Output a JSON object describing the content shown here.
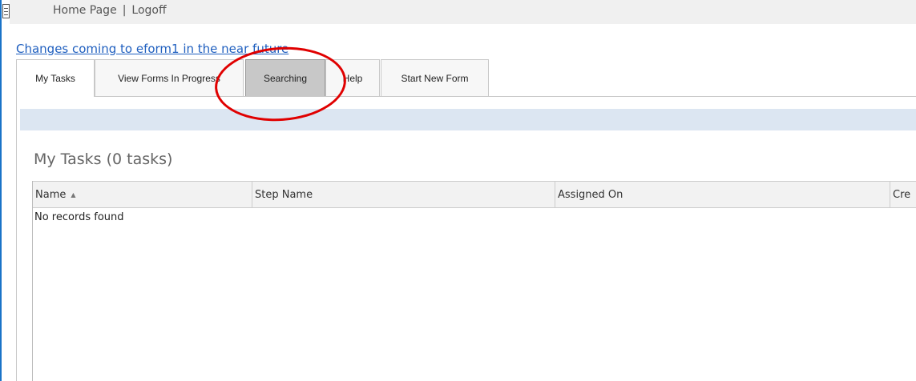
{
  "topnav": {
    "home": "Home Page",
    "separator": "|",
    "logoff": "Logoff"
  },
  "notice": {
    "text": "Changes coming to eform1 in the near future"
  },
  "tabs": [
    {
      "label": "My Tasks",
      "state": "active"
    },
    {
      "label": "View Forms In Progress",
      "state": "normal"
    },
    {
      "label": "Searching",
      "state": "highlighted"
    },
    {
      "label": "Help",
      "state": "normal"
    },
    {
      "label": "Start New Form",
      "state": "normal"
    }
  ],
  "section": {
    "title": "My Tasks (0 tasks)"
  },
  "grid": {
    "columns": [
      {
        "label": "Name",
        "sort": "ascending"
      },
      {
        "label": "Step Name"
      },
      {
        "label": "Assigned On"
      },
      {
        "label": "Cre"
      }
    ],
    "empty_message": "No records found",
    "rows": []
  },
  "icons": {
    "menu": "menu-icon",
    "sort": "sort-ascending-icon"
  },
  "colors": {
    "link": "#1f5fbf",
    "info_bar": "#dce6f2",
    "annotation": "#e00000",
    "highlight_tab": "#c8c8c8"
  }
}
